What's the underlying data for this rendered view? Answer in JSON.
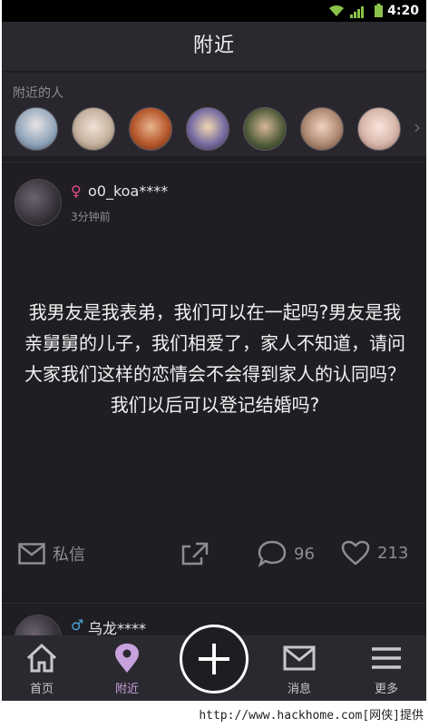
{
  "status_bar": {
    "time": "4:20",
    "icons": [
      "wifi-icon",
      "signal-icon",
      "battery-icon"
    ]
  },
  "header": {
    "title": "附近"
  },
  "nearby": {
    "label": "附近的人",
    "avatars": [
      {
        "color": "#8fa3b8"
      },
      {
        "color": "#c7b3a1"
      },
      {
        "color": "#b75a2e"
      },
      {
        "color": "#7b6fa3"
      },
      {
        "color": "#4f5a3a"
      },
      {
        "color": "#b08b74"
      },
      {
        "color": "#d7b7ac"
      }
    ]
  },
  "post": {
    "gender_symbol": "♀",
    "gender_color": "#e14b8a",
    "username": "o0_koa****",
    "time_ago": "3分钟前",
    "text": "我男友是我表弟，我们可以在一起吗?男友是我亲舅舅的儿子，我们相爱了，家人不知道，请问大家我们这样的恋情会不会得到家人的认同吗？我们以后可以登记结婚吗?",
    "message_label": "私信",
    "comment_count": "96",
    "like_count": "213"
  },
  "post2": {
    "gender_symbol": "♂",
    "gender_color": "#4aa3d8",
    "username": "乌龙****"
  },
  "bottom_nav": {
    "items": [
      {
        "label": "首页",
        "icon": "home-icon"
      },
      {
        "label": "附近",
        "icon": "location-icon"
      },
      {
        "label": "消息",
        "icon": "mail-icon"
      },
      {
        "label": "更多",
        "icon": "menu-icon"
      }
    ],
    "add_icon": "plus-icon"
  },
  "watermark": "http://www.hackhome.com[网侠]提供"
}
